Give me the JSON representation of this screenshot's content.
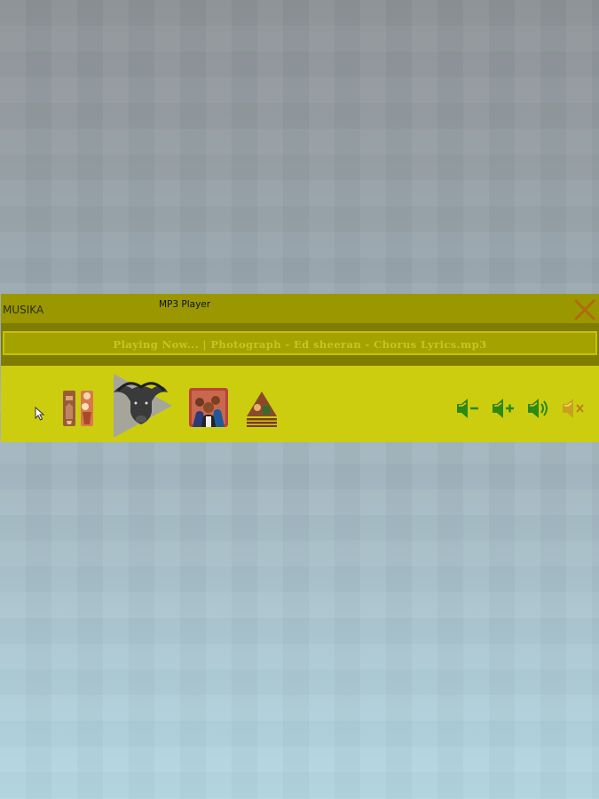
{
  "window": {
    "app_name": "MUSIKA",
    "title": "MP3 Player"
  },
  "now_playing": {
    "text": "Playing Now... | Photograph - Ed sheeran - Chorus Lyrics.mp3"
  },
  "controls": {
    "items": [
      {
        "name": "previous",
        "icon": "previous-figures-icon"
      },
      {
        "name": "play",
        "icon": "buffalo-play-icon"
      },
      {
        "name": "next",
        "icon": "people-group-icon"
      },
      {
        "name": "stop",
        "icon": "pyramid-figure-icon"
      }
    ],
    "volume": [
      {
        "name": "volume-down",
        "icon": "volume-down-icon"
      },
      {
        "name": "volume-up",
        "icon": "volume-up-icon"
      },
      {
        "name": "volume-on",
        "icon": "speaker-icon"
      },
      {
        "name": "mute",
        "icon": "mute-icon"
      }
    ]
  },
  "colors": {
    "titlebar": "#9a9700",
    "band": "#7e7d00",
    "controls_bg": "#cdcd0f",
    "close": "#b06a10",
    "volume_icons": "#2a8a12"
  }
}
